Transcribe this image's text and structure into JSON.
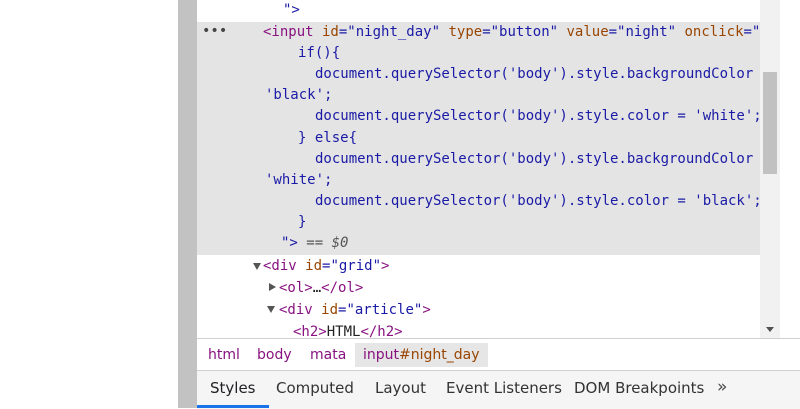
{
  "elements": {
    "ellipsis": "•••",
    "eq_marker": "== $0",
    "lines": [
      {
        "parts": [
          {
            "t": "\">",
            "c": "val"
          }
        ]
      },
      {
        "parts": [
          {
            "t": "<input",
            "c": "tag"
          },
          {
            "t": " id",
            "c": "attr"
          },
          {
            "t": "=\"night_day\"",
            "c": "val"
          },
          {
            "t": " type",
            "c": "attr"
          },
          {
            "t": "=\"button\"",
            "c": "val"
          },
          {
            "t": " value",
            "c": "attr"
          },
          {
            "t": "=\"night\"",
            "c": "val"
          },
          {
            "t": " onclick",
            "c": "attr"
          },
          {
            "t": "=\"",
            "c": "val"
          }
        ]
      },
      {
        "parts": [
          {
            "t": "if(){",
            "c": "js"
          }
        ]
      },
      {
        "parts": [
          {
            "t": "document.querySelector('body').style.backgroundColor =",
            "c": "js"
          }
        ]
      },
      {
        "parts": [
          {
            "t": "'black';",
            "c": "js"
          }
        ]
      },
      {
        "parts": [
          {
            "t": "document.querySelector('body').style.color = 'white';",
            "c": "js"
          }
        ]
      },
      {
        "parts": [
          {
            "t": "} else{",
            "c": "js"
          }
        ]
      },
      {
        "parts": [
          {
            "t": "document.querySelector('body').style.backgroundColor =",
            "c": "js"
          }
        ]
      },
      {
        "parts": [
          {
            "t": "'white';",
            "c": "js"
          }
        ]
      },
      {
        "parts": [
          {
            "t": "document.querySelector('body').style.color = 'black';",
            "c": "js"
          }
        ]
      },
      {
        "parts": [
          {
            "t": "}",
            "c": "js"
          }
        ]
      },
      {
        "parts": [
          {
            "t": "\">",
            "c": "val"
          }
        ]
      },
      {
        "parts": [
          {
            "t": "<div",
            "c": "tag"
          },
          {
            "t": " id",
            "c": "attr"
          },
          {
            "t": "=\"grid\"",
            "c": "val"
          },
          {
            "t": ">",
            "c": "tag"
          }
        ]
      },
      {
        "parts": [
          {
            "t": "<ol>",
            "c": "tag"
          },
          {
            "t": "…",
            "c": "plain"
          },
          {
            "t": "</ol>",
            "c": "tag"
          }
        ]
      },
      {
        "parts": [
          {
            "t": "<div",
            "c": "tag"
          },
          {
            "t": " id",
            "c": "attr"
          },
          {
            "t": "=\"article\"",
            "c": "val"
          },
          {
            "t": ">",
            "c": "tag"
          }
        ]
      },
      {
        "parts": [
          {
            "t": "<h2>",
            "c": "tag"
          },
          {
            "t": "HTML",
            "c": "plain"
          },
          {
            "t": "</h2>",
            "c": "tag"
          }
        ]
      }
    ]
  },
  "breadcrumb": {
    "items": [
      "html",
      "body",
      "mata"
    ],
    "active_tag": "input",
    "active_id": "#night_day"
  },
  "tabs": {
    "items": [
      "Styles",
      "Computed",
      "Layout",
      "Event Listeners",
      "DOM Breakpoints"
    ],
    "active": "Styles",
    "more": "»"
  },
  "colors": {
    "tag": "#881280",
    "attr": "#994500",
    "value": "#1a1aa6",
    "selected_bg": "#e4e4e4",
    "tab_accent": "#1a73e8"
  }
}
